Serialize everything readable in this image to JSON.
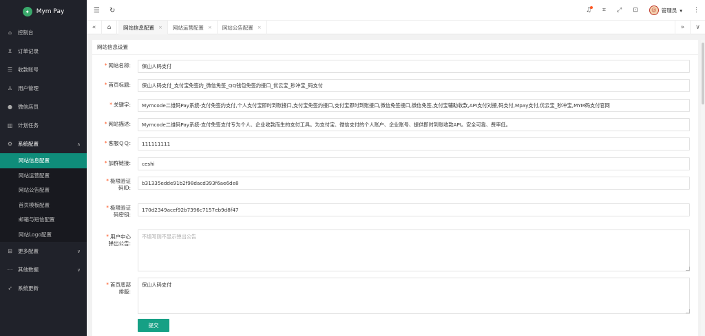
{
  "brand": {
    "name": "Mym Pay",
    "logo_icon": "leaf-icon"
  },
  "sidebar": {
    "items": [
      {
        "label": "控制台",
        "icon": "home-icon"
      },
      {
        "label": "订单记录",
        "icon": "cart-icon"
      },
      {
        "label": "收款账号",
        "icon": "list-icon"
      },
      {
        "label": "用户管理",
        "icon": "user-icon"
      },
      {
        "label": "微信店员",
        "icon": "wechat-icon"
      },
      {
        "label": "计划任务",
        "icon": "bar-chart-icon"
      },
      {
        "label": "系统配置",
        "icon": "gear-icon"
      }
    ],
    "sub_items": [
      "网站信息配置",
      "网站运营配置",
      "网站公告配置",
      "首页模板配置",
      "邮箱与短信配置",
      "网站Logo配置"
    ],
    "after_items": [
      {
        "label": "更多配置",
        "icon": "grid-icon"
      },
      {
        "label": "其他数据",
        "icon": "dots-icon"
      },
      {
        "label": "系统更新",
        "icon": "send-icon"
      }
    ]
  },
  "header": {
    "user": "管理员"
  },
  "tabs": [
    "网站信息配置",
    "网站运营配置",
    "网站公告配置"
  ],
  "card": {
    "title": "网站信息设置"
  },
  "form": {
    "site_name": {
      "label": "网站名称:",
      "value": "保山人码支付"
    },
    "home_title": {
      "label": "首页标题:",
      "value": "保山人码支付_支付宝免签约_微信免签_QQ钱包免签约接口_优云宝_秒冲宝_码支付"
    },
    "keywords": {
      "label": "关键字:",
      "value": "Mymcode二维码Pay系统-支付免签约支付,个人支付宝即时到账接口,支付宝免签约接口,支付宝即时到账接口,微信免签接口,微信免签,支付宝辅助收款,API支付对接,码支付,Mpay支付,优云宝_秒冲宝,MYM码支付官网"
    },
    "description": {
      "label": "网站描述:",
      "value": "Mymcode二维码Pay系统-支付免签支付专为个人、企业收款而生的支付工具。为支付宝、微信支付的个人账户、企业账号、提供即时到账收款API。安全可靠、费率低。"
    },
    "qq": {
      "label": "客服ＱＱ:",
      "value": "111111111"
    },
    "group_link": {
      "label": "加群链接:",
      "value": "ceshi"
    },
    "captcha_id": {
      "label_1": "极限验证",
      "label_2": "码ID:",
      "value": "b31335edde91b2f98dacd393f6ae6de8"
    },
    "captcha_key": {
      "label_1": "极限验证",
      "label_2": "码密钥:",
      "value": "170d2349acef92b7396c7157eb9d8f47"
    },
    "user_popup": {
      "label_1": "用户中心",
      "label_2": "弹出公告:",
      "placeholder": "不填写则不显示弹出公告"
    },
    "footer": {
      "label_1": "首页底部",
      "label_2": "排版:",
      "value": "保山人码支付"
    },
    "submit_label": "提交"
  }
}
